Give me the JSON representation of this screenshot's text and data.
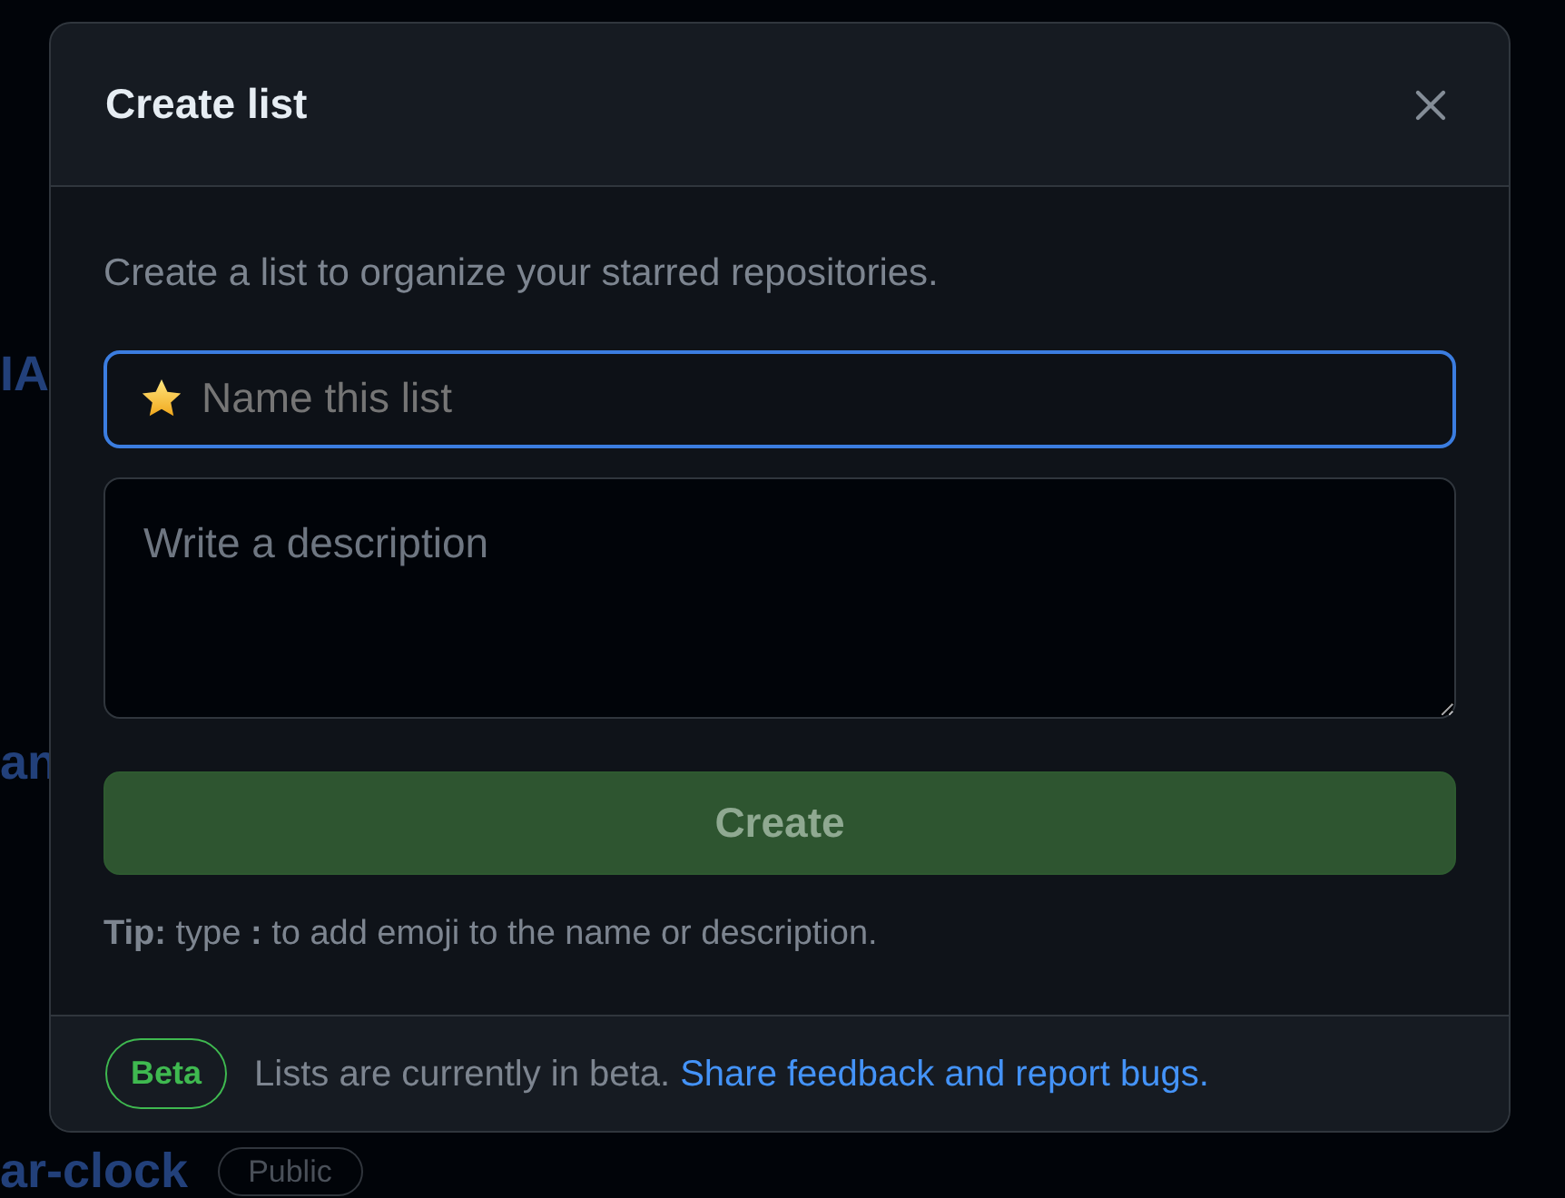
{
  "background": {
    "repositories": [
      {
        "name": "IA"
      },
      {
        "name": "an"
      },
      {
        "name": "ar-clock",
        "badge": "Public"
      }
    ]
  },
  "dialog": {
    "title": "Create list",
    "intro": "Create a list to organize your starred repositories.",
    "name_field": {
      "placeholder": "Name this list",
      "focused": true
    },
    "description_field": {
      "placeholder": "Write a description"
    },
    "create_button": {
      "label": "Create",
      "disabled": true
    },
    "tip": "**Tip:** type **:** to add emoji to the name or description.",
    "footer": {
      "badge": "Beta",
      "text": "Lists are currently in beta.",
      "link": "Share feedback and report bugs."
    }
  }
}
